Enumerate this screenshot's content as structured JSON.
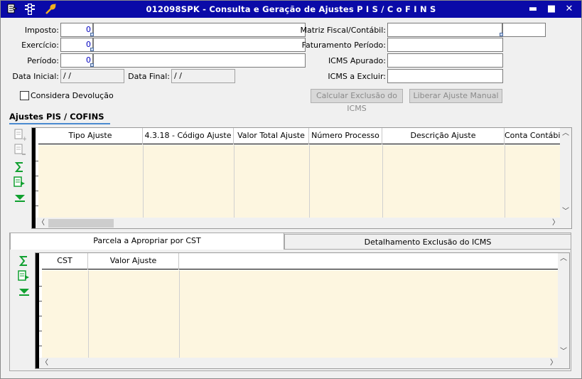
{
  "window": {
    "title": "012098SPK - Consulta e Geração de Ajustes P I S / C o F I N S"
  },
  "titlebar_icons": [
    "menu-icon",
    "traffic-light-icon",
    "wrench-icon"
  ],
  "window_controls": {
    "minimize": "▬",
    "maximize": "■",
    "close": "✕"
  },
  "form": {
    "imposto": {
      "label": "Imposto:",
      "value": "0"
    },
    "exercicio": {
      "label": "Exercício:",
      "value": "0"
    },
    "periodo": {
      "label": "Período:",
      "value": "0"
    },
    "data_inicial": {
      "label": "Data Inicial:",
      "value": " / /"
    },
    "data_final": {
      "label": "Data Final:",
      "value": " / /"
    },
    "considera_devolucao": {
      "label": "Considera Devolução",
      "checked": false
    },
    "matriz_fiscal": {
      "label": "Matriz Fiscal/Contábil:",
      "value": ""
    },
    "faturamento_periodo": {
      "label": "Faturamento Período:",
      "value": ""
    },
    "icms_apurado": {
      "label": "ICMS Apurado:",
      "value": ""
    },
    "icms_excluir": {
      "label": "ICMS a Excluir:",
      "value": ""
    },
    "calc_button": "Calcular Exclusão do ICMS",
    "liberar_button": "Liberar Ajuste Manual"
  },
  "ajustes": {
    "section_title": "Ajustes PIS / COFINS",
    "columns": [
      "Tipo Ajuste",
      "4.3.18 - Código Ajuste",
      "Valor Total Ajuste",
      "Número Processo",
      "Descrição Ajuste",
      "Conta Contábil"
    ],
    "rows": [],
    "toolbar_icons": [
      "add-row-icon",
      "remove-row-icon",
      "sum-icon",
      "export-icon",
      "expand-down-icon"
    ]
  },
  "tabs": {
    "items": [
      {
        "label": "Parcela a Apropriar por CST",
        "active": true
      },
      {
        "label": "Detalhamento Exclusão do ICMS",
        "active": false
      }
    ]
  },
  "parcela": {
    "columns": [
      "CST",
      "Valor Ajuste"
    ],
    "rows": [],
    "toolbar_icons": [
      "sum-icon",
      "export-icon",
      "expand-down-icon"
    ]
  },
  "colors": {
    "titlebar": "#0a0aa8",
    "grid_body": "#fdf6e0",
    "accent": "#4a8ad0"
  }
}
